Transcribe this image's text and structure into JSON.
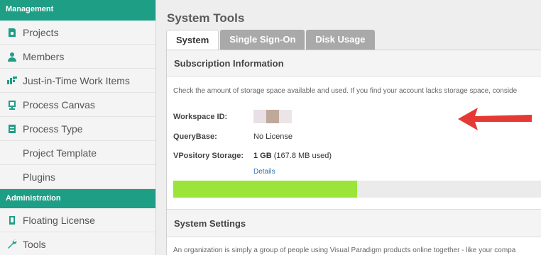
{
  "sidebar": {
    "sections": [
      {
        "header": "Management",
        "items": [
          {
            "label": "Projects",
            "icon": "projects-icon"
          },
          {
            "label": "Members",
            "icon": "members-icon"
          },
          {
            "label": "Just-in-Time Work Items",
            "icon": "work-items-icon"
          },
          {
            "label": "Process Canvas",
            "icon": "process-canvas-icon"
          },
          {
            "label": "Process Type",
            "icon": "process-type-icon"
          },
          {
            "label": "Project Template",
            "icon": ""
          },
          {
            "label": "Plugins",
            "icon": ""
          }
        ]
      },
      {
        "header": "Administration",
        "items": [
          {
            "label": "Floating License",
            "icon": "floating-license-icon"
          },
          {
            "label": "Tools",
            "icon": "wrench-icon"
          }
        ]
      }
    ]
  },
  "main": {
    "title": "System Tools",
    "tabs": [
      {
        "label": "System",
        "active": true
      },
      {
        "label": "Single Sign-On",
        "active": false
      },
      {
        "label": "Disk Usage",
        "active": false
      }
    ],
    "subscription": {
      "heading": "Subscription Information",
      "description": "Check the amount of storage space available and used. If you find your account lacks storage space, conside",
      "workspace_label": "Workspace ID:",
      "querybase_label": "QueryBase:",
      "querybase_value": "No License",
      "storage_label": "VPository Storage:",
      "storage_amount": "1 GB",
      "storage_used": "(167.8 MB used)",
      "details_link": "Details",
      "usage_fraction": 0.48
    },
    "settings": {
      "heading": "System Settings",
      "description": "An organization is simply a group of people using Visual Paradigm products online together - like your compa"
    }
  },
  "colors": {
    "accent": "#1f9e86",
    "bar_fill": "#9be53a",
    "arrow": "#e53935",
    "link": "#2a6fb5"
  }
}
